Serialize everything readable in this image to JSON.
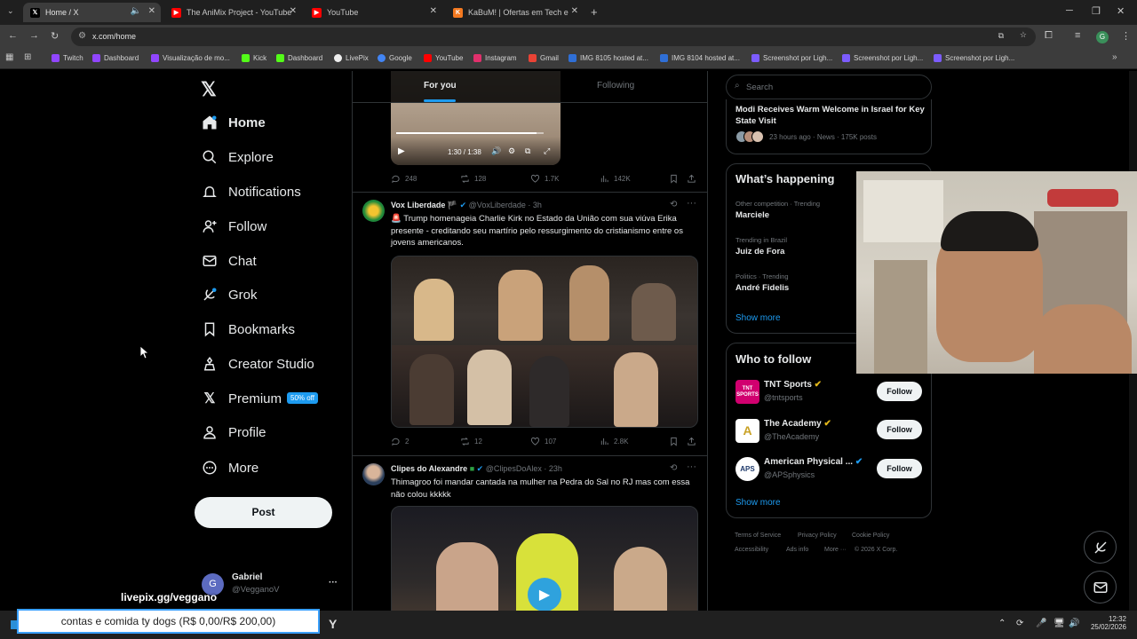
{
  "browser": {
    "tabs": [
      {
        "title": "Home / X",
        "active": true
      },
      {
        "title": "The AniMix Project - YouTube"
      },
      {
        "title": "YouTube"
      },
      {
        "title": "KaBuM! | Ofertas em Tech e Ga"
      }
    ],
    "url": "x.com/home",
    "bookmarks": [
      "Twitch",
      "Dashboard",
      "Visualização de mo...",
      "Kick",
      "Dashboard",
      "LivePix",
      "Google",
      "YouTube",
      "Instagram",
      "Gmail",
      "IMG 8105 hosted at...",
      "IMG 8104 hosted at...",
      "Screenshot por Ligh...",
      "Screenshot por Ligh...",
      "Screenshot por Ligh..."
    ]
  },
  "nav": {
    "items": [
      "Home",
      "Explore",
      "Notifications",
      "Follow",
      "Chat",
      "Grok",
      "Bookmarks",
      "Creator Studio",
      "Premium",
      "Profile",
      "More"
    ],
    "premium_badge": "50% off",
    "post_label": "Post",
    "user_name": "Gabriel",
    "user_handle": "@VegganoV",
    "user_initial": "G",
    "more_dots": "···"
  },
  "feed": {
    "tabs": [
      "For you",
      "Following"
    ],
    "video_time": "1:30 / 1:38",
    "tweet0_stats": {
      "replies": "248",
      "reposts": "128",
      "likes": "1.7K",
      "views": "142K"
    },
    "tweets": [
      {
        "name": "Vox Liberdade",
        "handle": "@VoxLiberdade",
        "time": "· 3h",
        "text": "🚨 Trump homenageia Charlie Kirk no Estado da União com sua viúva Erika presente - creditando seu martírio pelo ressurgimento do cristianismo entre os jovens americanos.",
        "replies": "2",
        "reposts": "12",
        "likes": "107",
        "views": "2.8K"
      },
      {
        "name": "Clipes do Alexandre",
        "handle": "@ClipesDoAlex",
        "time": "· 23h",
        "text": "Thimagroo foi mandar cantada na mulher na Pedra do Sal no RJ mas com essa não colou kkkkk"
      }
    ]
  },
  "right": {
    "search_placeholder": "Search",
    "news_title": "Modi Receives Warm Welcome in Israel for Key State Visit",
    "news_meta": "23 hours ago · News · 175K posts",
    "happening_title": "What’s happening",
    "trends": [
      {
        "context": "Other competition · Trending",
        "name": "Marciele"
      },
      {
        "context": "Trending in Brazil",
        "name": "Juiz de Fora"
      },
      {
        "context": "Politics · Trending",
        "name": "André Fidelis"
      }
    ],
    "show_more": "Show more",
    "wtf_title": "Who to follow",
    "follow": [
      {
        "name": "TNT Sports",
        "handle": "@tntsports",
        "logo": "TNT SPORTS"
      },
      {
        "name": "The Academy",
        "handle": "@TheAcademy",
        "logo": "A"
      },
      {
        "name": "American Physical ...",
        "handle": "@APSphysics",
        "logo": "APS"
      }
    ],
    "follow_label": "Follow",
    "footer": [
      "Terms of Service",
      "Privacy Policy",
      "Cookie Policy",
      "Accessibility",
      "Ads info",
      "More ···",
      "© 2026 X Corp."
    ]
  },
  "overlay": {
    "livepix": "livepix.gg/veggano",
    "goal": "contas e comida ty dogs (R$ 0,00/R$ 200,00)"
  },
  "taskbar": {
    "time": "12:32",
    "date": "25/02/2026"
  }
}
